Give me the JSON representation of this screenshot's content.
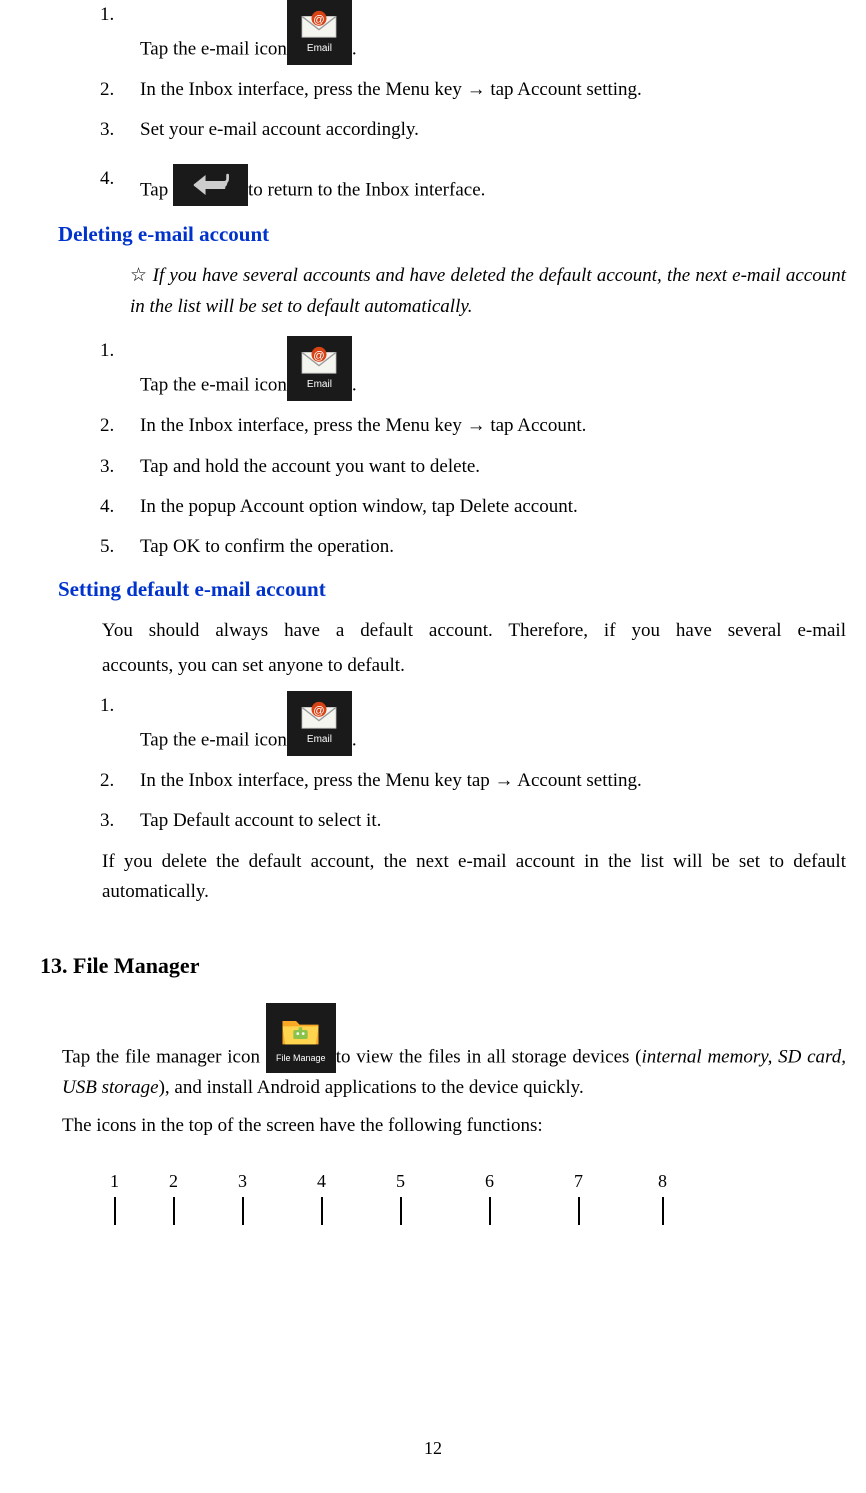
{
  "section1": {
    "step1": {
      "num": "1.",
      "text_before": "Tap the e-mail icon",
      "text_after": "."
    },
    "step2": {
      "num": "2.",
      "text": "In the Inbox interface, press the Menu key → tap Account setting."
    },
    "step3": {
      "num": "3.",
      "text": "Set your e-mail account accordingly."
    },
    "step4": {
      "num": "4.",
      "text_before": "Tap ",
      "text_after": "to return to the Inbox interface."
    }
  },
  "heading_deleting": "Deleting e-mail account",
  "star_note": "If you have several accounts and have deleted the default account, the next e-mail account in the list will be set to default automatically.",
  "section2": {
    "step1": {
      "num": "1.",
      "text_before": "Tap the e-mail icon",
      "text_after": "."
    },
    "step2": {
      "num": "2.",
      "text": "In the Inbox interface, press the Menu key → tap Account."
    },
    "step3": {
      "num": "3.",
      "text": "Tap and hold the account you want to delete."
    },
    "step4": {
      "num": "4.",
      "text": "In the popup Account option window, tap Delete account."
    },
    "step5": {
      "num": "5.",
      "text": "Tap OK to confirm the operation."
    }
  },
  "heading_default": "Setting default e-mail account",
  "default_intro_line1": "You should always have a default account. Therefore, if you have several e-mail",
  "default_intro_line2": "accounts, you can set anyone to default.",
  "section3": {
    "step1": {
      "num": "1.",
      "text_before": "Tap the e-mail icon",
      "text_after": "."
    },
    "step2": {
      "num": "2.",
      "text": "In the Inbox interface, press the Menu key tap → Account setting."
    },
    "step3": {
      "num": "3.",
      "text": "Tap Default account to select it."
    }
  },
  "default_outro": "If you delete the default account, the next e-mail account in the list will be set to default automatically.",
  "heading_fm": "13. File Manager",
  "fm_text_before": "Tap the file manager icon ",
  "fm_text_after": "to view the files in all storage devices (",
  "fm_italic": "internal memory, SD card, USB storage",
  "fm_text_end": "), and install Android applications to the device quickly.",
  "fm_icons_intro": "The icons in the top of the screen have the following functions:",
  "numbers": [
    "1",
    "2",
    "3",
    "4",
    "5",
    "6",
    "7",
    "8"
  ],
  "icon_labels": {
    "email": "Email",
    "file_manager": "File Manage"
  },
  "page_number": "12"
}
